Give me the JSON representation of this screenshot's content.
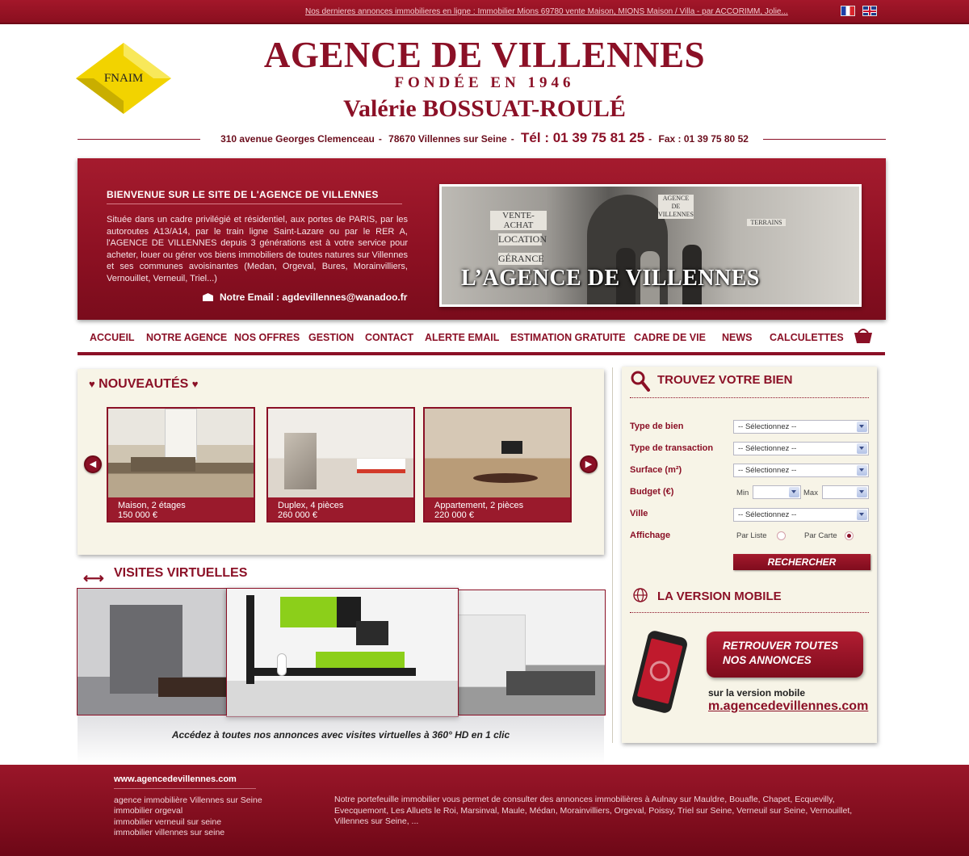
{
  "topbar": {
    "ticker": "Nos dernieres annonces immobilieres en ligne :  Immobilier Mions 69780 vente Maison, MIONS Maison / Villa - par ACCORIMM,  Jolie..."
  },
  "header": {
    "logo_text": "FNAIM",
    "title": "AGENCE DE VILLENNES",
    "founded": "FONDÉE EN 1946",
    "owner": "Valérie BOSSUAT-ROULÉ",
    "address": "310 avenue Georges Clemenceau",
    "city": "78670 Villennes sur Seine",
    "tel": "Tél : 01 39 75 81 25",
    "fax": "Fax : 01 39 75 80 52"
  },
  "hero": {
    "title": "BIENVENUE SUR LE SITE DE L'AGENCE DE VILLENNES",
    "text": "Située dans un cadre privilégié et résidentiel, aux portes de PARIS, par les autoroutes A13/A14, par le train ligne Saint-Lazare ou par le RER A, l'AGENCE DE VILLENNES depuis 3 générations est à votre service pour acheter, louer ou gérer vos biens immobiliers de toutes natures sur Villennes et ses communes avoisinantes (Medan, Orgeval, Bures, Morainvilliers, Vernouillet, Verneuil, Triel...)",
    "email": "Notre Email : agdevillennes@wanadoo.fr",
    "photo_caption": "L’AGENCE DE VILLENNES",
    "photo_signs": [
      "VENTE-ACHAT",
      "LOCATION",
      "GÉRANCE",
      "AGENCE DE VILLENNES",
      "TERRAINS"
    ]
  },
  "nav": {
    "items": [
      "ACCUEIL",
      "NOTRE AGENCE",
      "NOS OFFRES",
      "GESTION",
      "CONTACT",
      "ALERTE EMAIL",
      "ESTIMATION GRATUITE",
      "CADRE DE VIE",
      "NEWS",
      "CALCULETTES"
    ]
  },
  "nouveautes": {
    "title": "NOUVEAUTÉS",
    "cards": [
      {
        "type": "Maison, 2 étages",
        "price": "150 000 €"
      },
      {
        "type": "Duplex, 4 pièces",
        "price": "260 000 €"
      },
      {
        "type": "Appartement, 2 pièces",
        "price": "220 000 €"
      }
    ]
  },
  "visites": {
    "title": "VISITES VIRTUELLES",
    "caption": "Accédez à toutes nos annonces avec visites virtuelles à 360° HD en 1 clic"
  },
  "search": {
    "title": "TROUVEZ VOTRE BIEN",
    "labels": {
      "type_bien": "Type de bien",
      "type_transaction": "Type de transaction",
      "surface": "Surface (m²)",
      "budget": "Budget (€)",
      "ville": "Ville",
      "affichage": "Affichage"
    },
    "select_placeholder": "-- Sélectionnez --",
    "min_label": "Min",
    "max_label": "Max",
    "par_liste": "Par Liste",
    "par_carte": "Par Carte",
    "button": "RECHERCHER"
  },
  "mobile": {
    "title": "LA VERSION MOBILE",
    "bubble": "RETROUVER TOUTES NOS ANNONCES",
    "sub": "sur la version mobile",
    "url": "m.agencedevillennes.com"
  },
  "footer": {
    "site": "www.agencedevillennes.com",
    "links": [
      "agence immobilière Villennes sur Seine",
      "immobilier orgeval",
      "immobilier verneuil sur seine",
      "immobilier villennes sur seine"
    ],
    "text": "Notre portefeuille immobilier vous permet de consulter des annonces immobilières à Aulnay sur Mauldre, Bouafle, Chapet, Ecquevilly, Evecquemont, Les Alluets le Roi, Marsinval, Maule, Médan, Morainvilliers, Orgeval, Poissy, Triel sur Seine, Verneuil sur Seine, Vernouillet, Villennes sur Seine, ..."
  },
  "colors": {
    "brand": "#8b1026",
    "panel": "#f7f4e7",
    "logo_yellow": "#f2d300"
  }
}
